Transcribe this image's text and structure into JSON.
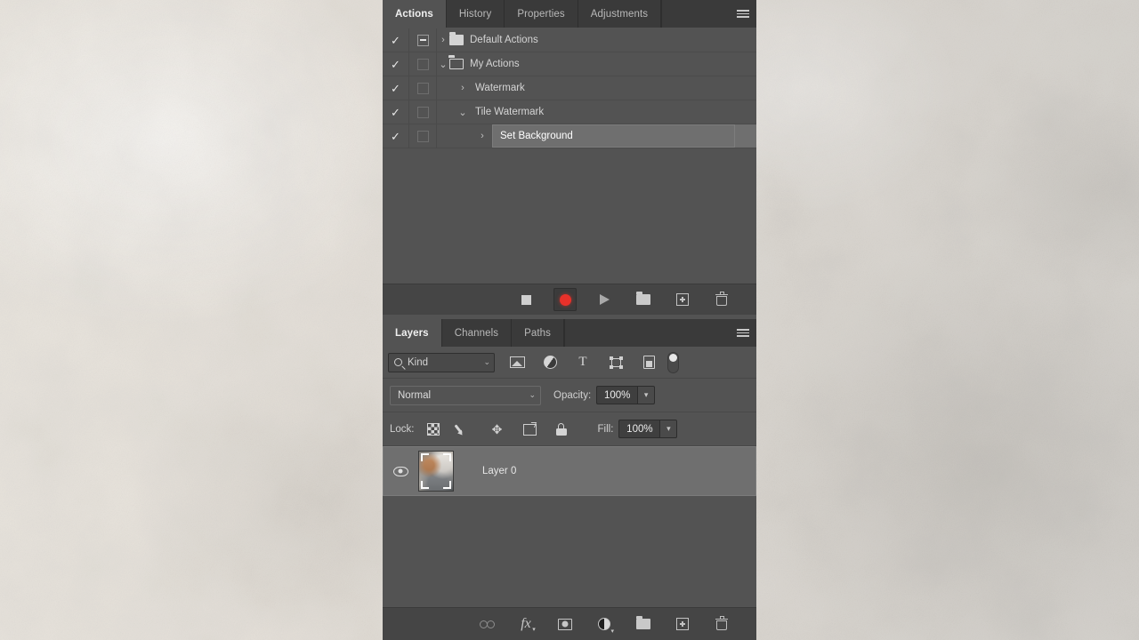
{
  "background": {
    "description": "textured beige plaster wall photo",
    "color_left": "#eae6df",
    "color_right": "#d5d2cd"
  },
  "actions_panel": {
    "tabs": [
      {
        "label": "Actions",
        "active": true
      },
      {
        "label": "History",
        "active": false
      },
      {
        "label": "Properties",
        "active": false
      },
      {
        "label": "Adjustments",
        "active": false
      }
    ],
    "menu_icon": "hamburger-menu-icon",
    "rows": [
      {
        "label": "Default Actions",
        "checked": "✓",
        "dialog_toggle": "on",
        "twisty": "›",
        "expanded": false,
        "icon": "folder-icon",
        "indent": 0,
        "selected": false
      },
      {
        "label": "My Actions",
        "checked": "✓",
        "dialog_toggle": "blank",
        "twisty": "⌄",
        "expanded": true,
        "icon": "folder-open-icon",
        "indent": 0,
        "selected": false
      },
      {
        "label": "Watermark",
        "checked": "✓",
        "dialog_toggle": "blank",
        "twisty": "›",
        "expanded": false,
        "icon": "none",
        "indent": 1,
        "selected": false
      },
      {
        "label": "Tile Watermark",
        "checked": "✓",
        "dialog_toggle": "blank",
        "twisty": "⌄",
        "expanded": true,
        "icon": "none",
        "indent": 1,
        "selected": false
      },
      {
        "label": "Set Background",
        "checked": "✓",
        "dialog_toggle": "blank",
        "twisty": "›",
        "expanded": false,
        "icon": "none",
        "indent": 2,
        "selected": true
      }
    ],
    "toolbar": [
      {
        "name": "stop-playing-recording-button",
        "icon": "stop-icon",
        "pressed": false
      },
      {
        "name": "begin-recording-button",
        "icon": "record-icon",
        "pressed": true
      },
      {
        "name": "play-selection-button",
        "icon": "play-icon",
        "pressed": false
      },
      {
        "name": "create-new-set-button",
        "icon": "folder-icon",
        "pressed": false
      },
      {
        "name": "create-new-action-button",
        "icon": "plus-box-icon",
        "pressed": false
      },
      {
        "name": "delete-button",
        "icon": "trash-icon",
        "pressed": false
      }
    ],
    "record_color": "#e8312a"
  },
  "layers_panel": {
    "tabs": [
      {
        "label": "Layers",
        "active": true
      },
      {
        "label": "Channels",
        "active": false
      },
      {
        "label": "Paths",
        "active": false
      }
    ],
    "menu_icon": "hamburger-menu-icon",
    "filter": {
      "kind_label": "Kind",
      "search_icon": "search-icon",
      "caret": "⌄",
      "icons": [
        "filter-pixel-layers-icon",
        "filter-adjustment-layers-icon",
        "filter-type-layers-icon",
        "filter-shape-layers-icon",
        "filter-smart-object-icon"
      ],
      "toggle_name": "filter-enable-toggle"
    },
    "blend": {
      "mode": "Normal",
      "caret": "⌄",
      "opacity_label": "Opacity:",
      "opacity_value": "100%"
    },
    "lock": {
      "label": "Lock:",
      "icons": [
        "lock-transparent-pixels-icon",
        "lock-image-pixels-icon",
        "lock-position-icon",
        "lock-artboard-nesting-icon",
        "lock-all-icon"
      ],
      "fill_label": "Fill:",
      "fill_value": "100%"
    },
    "layers": [
      {
        "name": "Layer 0",
        "visible": true,
        "visibility_icon": "eye-icon",
        "thumbnail": "interior-photo-thumbnail",
        "selected": true
      }
    ],
    "toolbar": [
      {
        "name": "link-layers-button",
        "icon": "link-icon"
      },
      {
        "name": "layer-style-button",
        "icon": "fx-icon"
      },
      {
        "name": "add-layer-mask-button",
        "icon": "mask-icon"
      },
      {
        "name": "new-adjustment-layer-button",
        "icon": "adjustment-icon"
      },
      {
        "name": "new-group-button",
        "icon": "folder-icon"
      },
      {
        "name": "new-layer-button",
        "icon": "plus-box-icon"
      },
      {
        "name": "delete-layer-button",
        "icon": "trash-icon"
      }
    ]
  }
}
